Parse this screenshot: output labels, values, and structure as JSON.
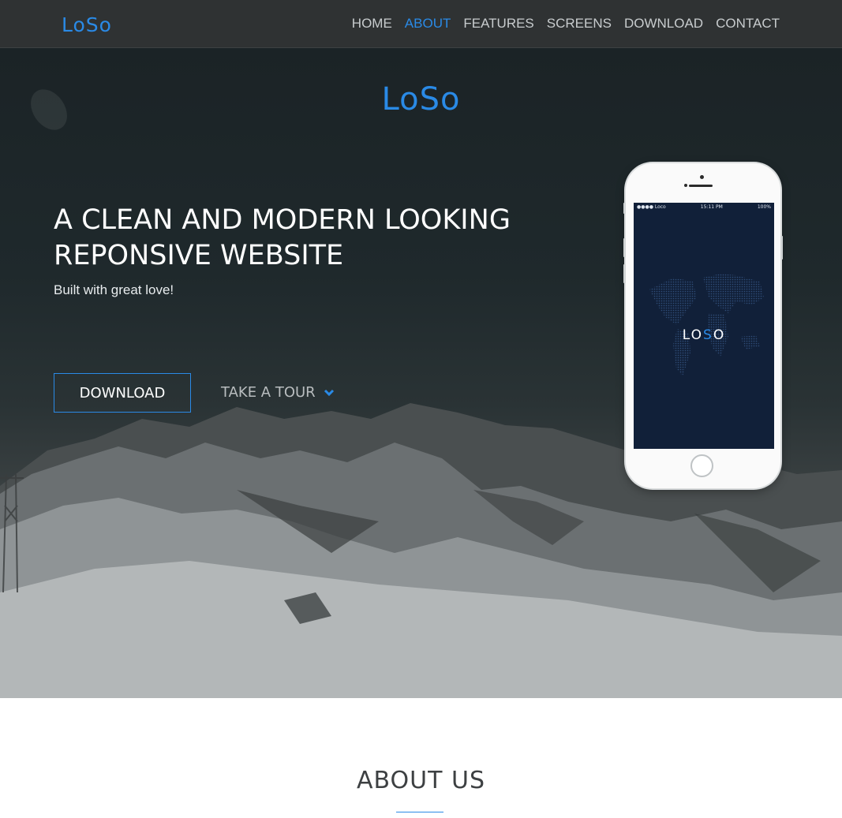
{
  "nav": {
    "logo": "LoSo",
    "items": [
      {
        "label": "HOME",
        "active": false
      },
      {
        "label": "ABOUT",
        "active": true
      },
      {
        "label": "FEATURES",
        "active": false
      },
      {
        "label": "SCREENS",
        "active": false
      },
      {
        "label": "DOWNLOAD",
        "active": false
      },
      {
        "label": "CONTACT",
        "active": false
      }
    ]
  },
  "hero": {
    "logo": "LoSo",
    "title_line1": "A CLEAN AND MODERN LOOKING",
    "title_line2": "REPONSIVE WEBSITE",
    "subtitle": "Built with great love!",
    "download_label": "DOWNLOAD",
    "tour_label": "TAKE A TOUR",
    "tour_icon": "chevron-down-icon"
  },
  "phone": {
    "status_left": "●●●● Loco",
    "status_time": "15:11 PM",
    "status_battery": "100%",
    "app_logo_left": "LO",
    "app_logo_accent": "S",
    "app_logo_right": "O"
  },
  "about": {
    "title": "ABOUT US"
  },
  "colors": {
    "accent": "#2a8ae6",
    "navbar": "#2f3233",
    "phone_screen": "#112039"
  }
}
